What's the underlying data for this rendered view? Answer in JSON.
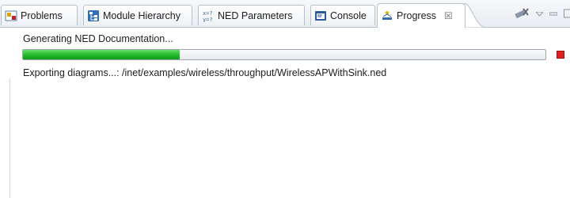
{
  "tabs": [
    {
      "label": "Problems",
      "icon": "problems-icon",
      "active": false
    },
    {
      "label": "Module Hierarchy",
      "icon": "module-hierarchy-icon",
      "active": false
    },
    {
      "label": "NED Parameters",
      "icon": "ned-parameters-icon",
      "active": false
    },
    {
      "label": "Console",
      "icon": "console-icon",
      "active": false
    },
    {
      "label": "Progress",
      "icon": "progress-icon",
      "active": true,
      "close_glyph": "☒"
    }
  ],
  "view_tools": {
    "icons": [
      "remove-all-finished-icon",
      "view-menu-icon",
      "minimize-icon",
      "maximize-icon"
    ]
  },
  "progress": {
    "job_title": "Generating NED Documentation...",
    "fraction": 0.3,
    "task_text": "Exporting diagrams...: /inet/examples/wireless/throughput/WirelessAPWithSink.ned"
  },
  "colors": {
    "progress_green": "#22b92a",
    "stop_red": "#e02020",
    "tab_border": "#b8c0cc"
  }
}
